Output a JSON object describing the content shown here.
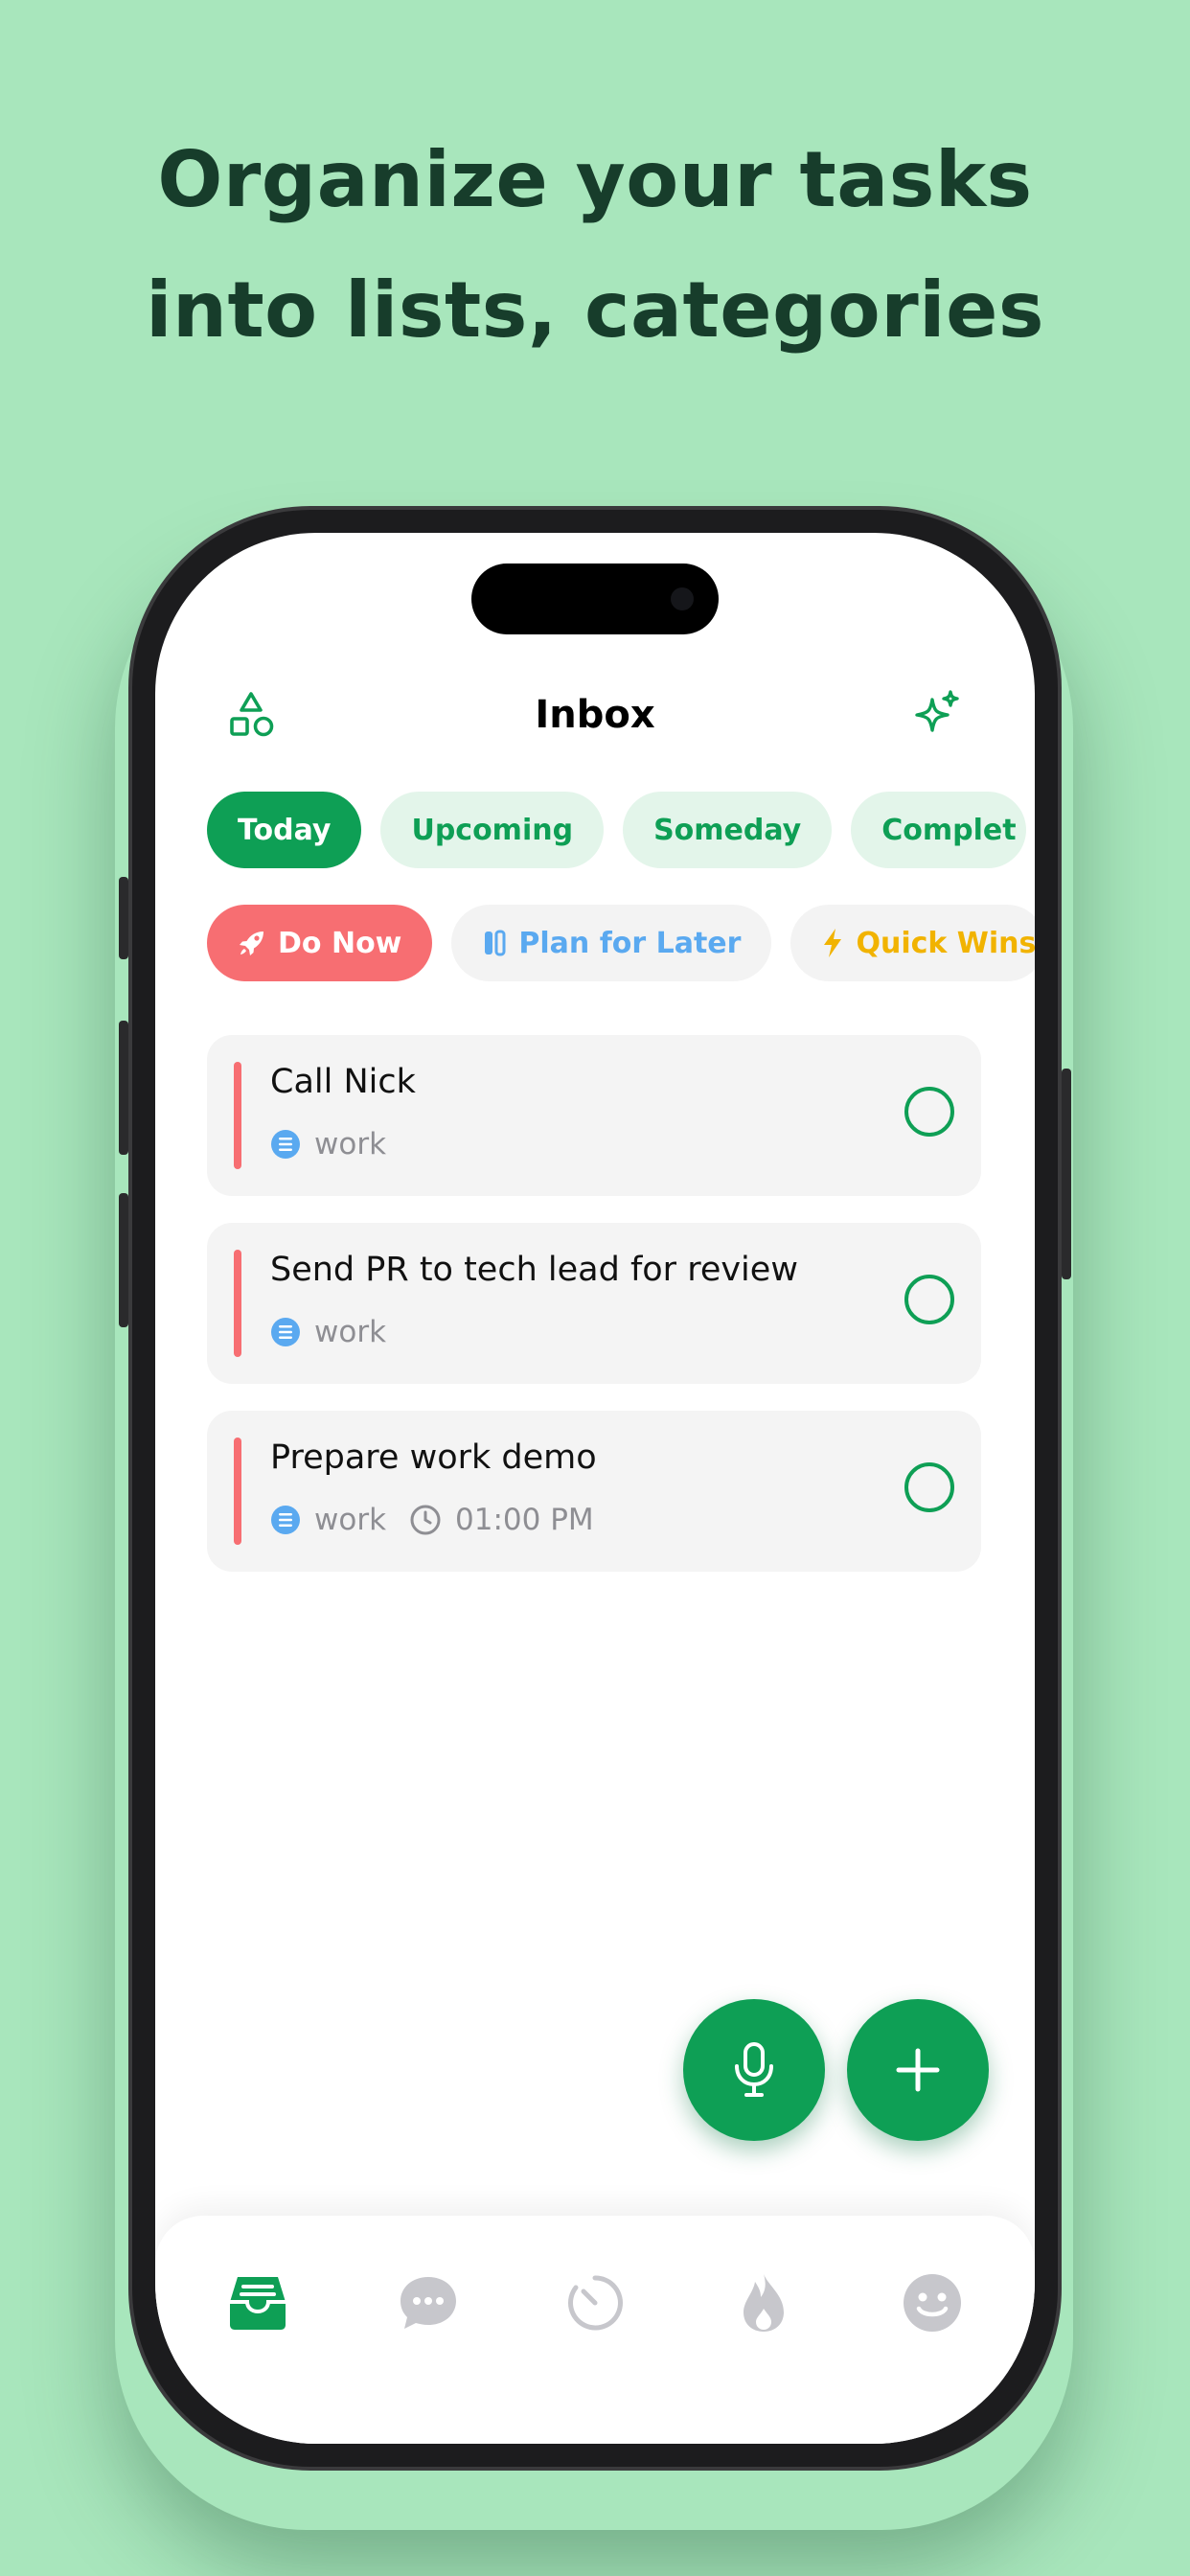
{
  "headline": {
    "line1": "Organize your tasks",
    "line2": "into lists, categories"
  },
  "colors": {
    "accent": "#0e9f55",
    "background": "#a8e6bc",
    "priority_red": "#f76e72",
    "plan_blue": "#5aa9f0",
    "quick_yellow": "#f1b300"
  },
  "header": {
    "title": "Inbox",
    "left_icon": "shapes-icon",
    "right_icon": "sparkles-icon"
  },
  "tabs": [
    {
      "label": "Today",
      "active": true
    },
    {
      "label": "Upcoming",
      "active": false
    },
    {
      "label": "Someday",
      "active": false
    },
    {
      "label": "Complet",
      "active": false
    }
  ],
  "filters": [
    {
      "label": "Do Now",
      "icon": "rocket-icon"
    },
    {
      "label": "Plan for Later",
      "icon": "calendar-icon"
    },
    {
      "label": "Quick Wins",
      "icon": "lightning-icon"
    }
  ],
  "tasks": [
    {
      "title": "Call Nick",
      "list": "work",
      "time": ""
    },
    {
      "title": "Send PR to tech lead for review",
      "list": "work",
      "time": ""
    },
    {
      "title": "Prepare work demo",
      "list": "work",
      "time": "01:00 PM"
    }
  ],
  "fabs": {
    "mic": "microphone-icon",
    "add": "plus-icon"
  },
  "nav": [
    {
      "icon": "inbox-icon",
      "active": true
    },
    {
      "icon": "chat-icon",
      "active": false
    },
    {
      "icon": "timer-icon",
      "active": false
    },
    {
      "icon": "flame-icon",
      "active": false
    },
    {
      "icon": "smiley-icon",
      "active": false
    }
  ]
}
